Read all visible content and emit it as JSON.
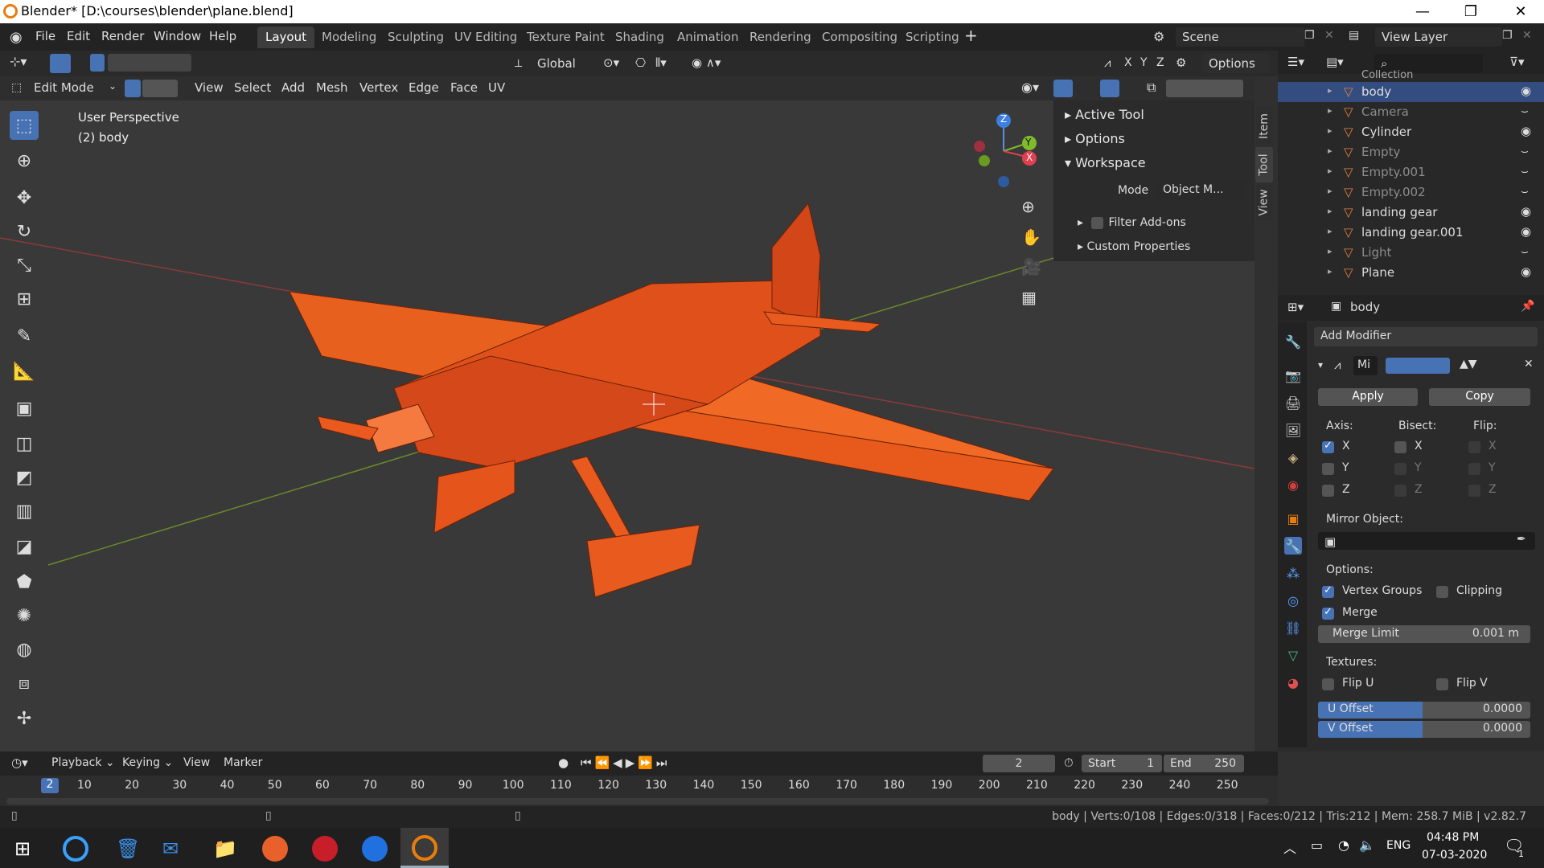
{
  "window": {
    "title": "Blender* [D:\\courses\\blender\\plane.blend]",
    "minimize": "—",
    "maximize": "❐",
    "close": "✕"
  },
  "menu": {
    "file": "File",
    "edit": "Edit",
    "render": "Render",
    "window": "Window",
    "help": "Help"
  },
  "workspaces": [
    "Layout",
    "Modeling",
    "Sculpting",
    "UV Editing",
    "Texture Paint",
    "Shading",
    "Animation",
    "Rendering",
    "Compositing",
    "Scripting"
  ],
  "scene": {
    "scene_name": "Scene",
    "view_layer": "View Layer"
  },
  "viewport_header": {
    "transform_orientation": "Global",
    "options": "Options",
    "axis_x": "X",
    "axis_y": "Y",
    "axis_z": "Z"
  },
  "editmode_header": {
    "mode": "Edit Mode",
    "view": "View",
    "select": "Select",
    "add": "Add",
    "mesh": "Mesh",
    "vertex": "Vertex",
    "edge": "Edge",
    "face": "Face",
    "uv": "UV"
  },
  "viewport": {
    "perspective": "User Perspective",
    "object": "(2) body",
    "gizmo_x": "X",
    "gizmo_y": "Y",
    "gizmo_z": "Z"
  },
  "npanel": {
    "active_tool": "Active Tool",
    "options": "Options",
    "workspace": "Workspace",
    "mode_label": "Mode",
    "mode_value": "Object M...",
    "filter_addons": "Filter Add-ons",
    "custom_properties": "Custom Properties",
    "tabs": [
      "Item",
      "Tool",
      "View"
    ]
  },
  "outliner": {
    "collection": "Collection",
    "items": [
      {
        "name": "body",
        "selected": true,
        "dim": false
      },
      {
        "name": "Camera",
        "selected": false,
        "dim": true
      },
      {
        "name": "Cylinder",
        "selected": false,
        "dim": false
      },
      {
        "name": "Empty",
        "selected": false,
        "dim": true
      },
      {
        "name": "Empty.001",
        "selected": false,
        "dim": true
      },
      {
        "name": "Empty.002",
        "selected": false,
        "dim": true
      },
      {
        "name": "landing gear",
        "selected": false,
        "dim": false
      },
      {
        "name": "landing gear.001",
        "selected": false,
        "dim": false
      },
      {
        "name": "Light",
        "selected": false,
        "dim": true
      },
      {
        "name": "Plane",
        "selected": false,
        "dim": false
      }
    ]
  },
  "properties": {
    "object_name": "body",
    "add_modifier": "Add Modifier",
    "modifier_name": "Mi",
    "apply": "Apply",
    "copy": "Copy",
    "axis": "Axis:",
    "bisect": "Bisect:",
    "flip": "Flip:",
    "x": "X",
    "y": "Y",
    "z": "Z",
    "mirror_object": "Mirror Object:",
    "options": "Options:",
    "vertex_groups": "Vertex Groups",
    "clipping": "Clipping",
    "merge": "Merge",
    "merge_limit": "Merge Limit",
    "merge_limit_value": "0.001 m",
    "textures": "Textures:",
    "flip_u": "Flip U",
    "flip_v": "Flip V",
    "u_offset": "U Offset",
    "u_offset_value": "0.0000",
    "v_offset": "V Offset",
    "v_offset_value": "0.0000"
  },
  "timeline": {
    "playback": "Playback",
    "keying": "Keying",
    "view": "View",
    "marker": "Marker",
    "current_frame": "2",
    "start_label": "Start",
    "start_value": "1",
    "end_label": "End",
    "end_value": "250",
    "ruler_current": "2",
    "ruler": [
      "10",
      "20",
      "30",
      "40",
      "50",
      "60",
      "70",
      "80",
      "90",
      "100",
      "110",
      "120",
      "130",
      "140",
      "150",
      "160",
      "170",
      "180",
      "190",
      "200",
      "210",
      "220",
      "230",
      "240",
      "250"
    ]
  },
  "status": {
    "text": "body | Verts:0/108 | Edges:0/318 | Faces:0/212 | Tris:212 | Mem: 258.7 MiB | v2.82.7"
  },
  "taskbar": {
    "lang": "ENG",
    "time": "04:48 PM",
    "date": "07-03-2020",
    "notif_count": "1"
  },
  "colors": {
    "accent": "#4772b3",
    "plane": "#e8531a",
    "outliner_selected": "#334d80"
  }
}
